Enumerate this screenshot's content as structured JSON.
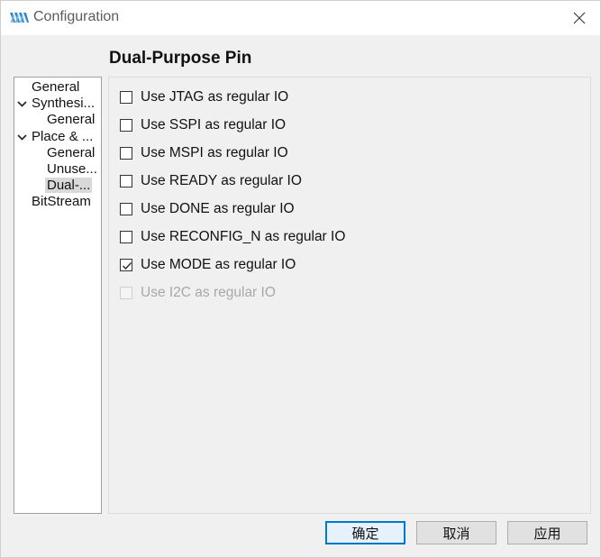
{
  "window": {
    "title": "Configuration",
    "icon": "gowin-logo-icon",
    "close_icon": "close-icon"
  },
  "page": {
    "title": "Dual-Purpose Pin"
  },
  "tree": {
    "items": [
      {
        "label": "General"
      },
      {
        "label": "Synthesi..."
      },
      {
        "label": "General"
      },
      {
        "label": "Place & ..."
      },
      {
        "label": "General"
      },
      {
        "label": "Unuse..."
      },
      {
        "label": "Dual-..."
      },
      {
        "label": "BitStream"
      }
    ],
    "selected_index": 6
  },
  "options": [
    {
      "label": "Use JTAG as regular IO",
      "checked": false,
      "enabled": true
    },
    {
      "label": "Use SSPI as regular IO",
      "checked": false,
      "enabled": true
    },
    {
      "label": "Use MSPI as regular IO",
      "checked": false,
      "enabled": true
    },
    {
      "label": "Use READY as regular IO",
      "checked": false,
      "enabled": true
    },
    {
      "label": "Use DONE as regular IO",
      "checked": false,
      "enabled": true
    },
    {
      "label": "Use RECONFIG_N as regular IO",
      "checked": false,
      "enabled": true
    },
    {
      "label": "Use MODE as regular IO",
      "checked": true,
      "enabled": true
    },
    {
      "label": "Use I2C as regular IO",
      "checked": false,
      "enabled": false
    }
  ],
  "buttons": {
    "ok": "确定",
    "cancel": "取消",
    "apply": "应用"
  },
  "colors": {
    "accent": "#0078d7",
    "selection": "#d9d9d9",
    "disabled_text": "#a8a8a8"
  }
}
